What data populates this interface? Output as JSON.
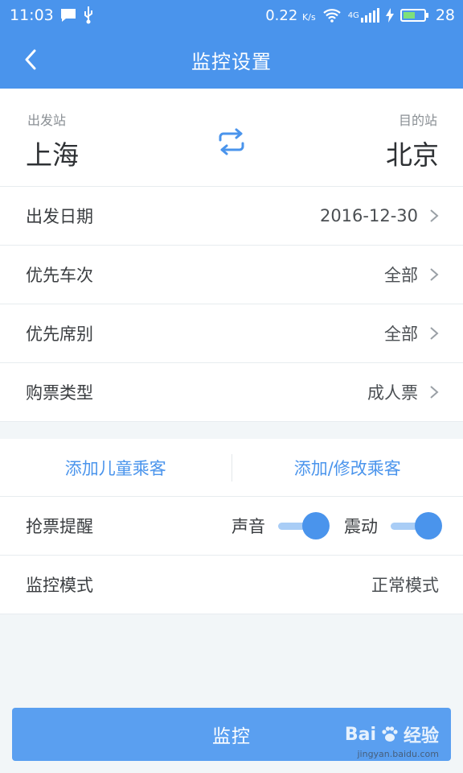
{
  "status_bar": {
    "time": "11:03",
    "speed": "0.22",
    "speed_unit": "K/s",
    "network": "4G",
    "battery": "28",
    "icons": [
      "message-icon",
      "usb-icon",
      "wifi-icon",
      "signal-icon",
      "charging-icon",
      "battery-icon"
    ]
  },
  "header": {
    "title": "监控设置",
    "back_icon": "chevron-left-icon"
  },
  "stations": {
    "from_label": "出发站",
    "from_name": "上海",
    "to_label": "目的站",
    "to_name": "北京",
    "swap_icon": "swap-arrows-icon"
  },
  "settings": [
    {
      "label": "出发日期",
      "value": "2016-12-30"
    },
    {
      "label": "优先车次",
      "value": "全部"
    },
    {
      "label": "优先席别",
      "value": "全部"
    },
    {
      "label": "购票类型",
      "value": "成人票"
    }
  ],
  "passengers": {
    "add_child": "添加儿童乘客",
    "add_edit": "添加/修改乘客"
  },
  "reminder": {
    "label": "抢票提醒",
    "sound_label": "声音",
    "sound_on": true,
    "vibrate_label": "震动",
    "vibrate_on": true
  },
  "mode": {
    "label": "监控模式",
    "value": "正常模式"
  },
  "action": {
    "monitor_label": "监控"
  },
  "watermark": {
    "brand_left": "Bai",
    "brand_right": "经验",
    "url": "jingyan.baidu.com"
  },
  "colors": {
    "primary": "#4a94ec",
    "background": "#f2f6f8",
    "toggle_track": "#a9cdf6"
  }
}
